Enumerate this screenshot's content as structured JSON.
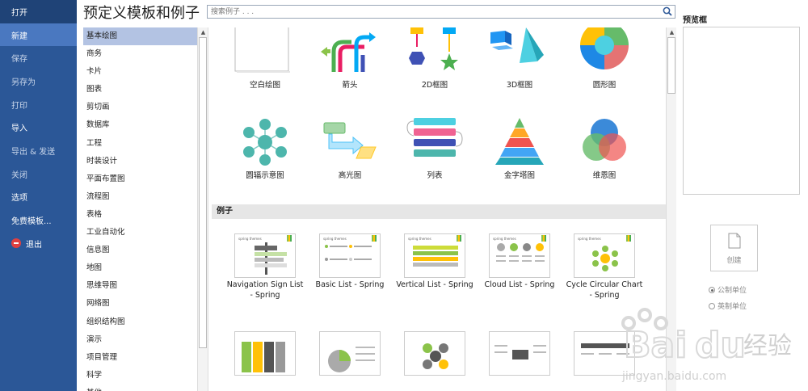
{
  "nav": {
    "items": [
      {
        "label": "打开"
      },
      {
        "label": "新建"
      },
      {
        "label": "保存"
      },
      {
        "label": "另存为"
      },
      {
        "label": "打印"
      },
      {
        "label": "导入"
      },
      {
        "label": "导出 & 发送"
      },
      {
        "label": "关闭"
      },
      {
        "label": "选项"
      },
      {
        "label": "免费模板..."
      },
      {
        "label": "退出"
      }
    ]
  },
  "header": {
    "title": "预定义模板和例子",
    "search_placeholder": "搜索例子 . . ."
  },
  "categories": [
    "基本绘图",
    "商务",
    "卡片",
    "图表",
    "剪切画",
    "数据库",
    "工程",
    "时装设计",
    "平面布置图",
    "流程图",
    "表格",
    "工业自动化",
    "信息图",
    "地图",
    "思维导图",
    "网络图",
    "组织结构图",
    "演示",
    "项目管理",
    "科学",
    "其他"
  ],
  "templates": [
    {
      "label": "空白绘图"
    },
    {
      "label": "箭头"
    },
    {
      "label": "2D框图"
    },
    {
      "label": "3D框图"
    },
    {
      "label": "圆形图"
    },
    {
      "label": "圆辐示意图"
    },
    {
      "label": "高光图"
    },
    {
      "label": "列表"
    },
    {
      "label": "金字塔图"
    },
    {
      "label": "维恩图"
    }
  ],
  "examples_header": "例子",
  "examples": [
    {
      "label": "Navigation Sign List - Spring"
    },
    {
      "label": "Basic List - Spring"
    },
    {
      "label": "Vertical List - Spring"
    },
    {
      "label": "Cloud List - Spring"
    },
    {
      "label": "Cycle Circular Chart - Spring"
    }
  ],
  "example_thumb_header": "spring themes",
  "preview": {
    "label": "预览框",
    "create_label": "创建",
    "unit_metric": "公制单位",
    "unit_imperial": "英制单位"
  },
  "watermark": {
    "brand": "Bai",
    "brand2": "du",
    "cn": "经验",
    "url": "jingyan.baidu.com"
  },
  "colors": {
    "nav_bg": "#2b5797",
    "nav_active": "#4a78c0",
    "selected_cat": "#b3c3e3"
  }
}
